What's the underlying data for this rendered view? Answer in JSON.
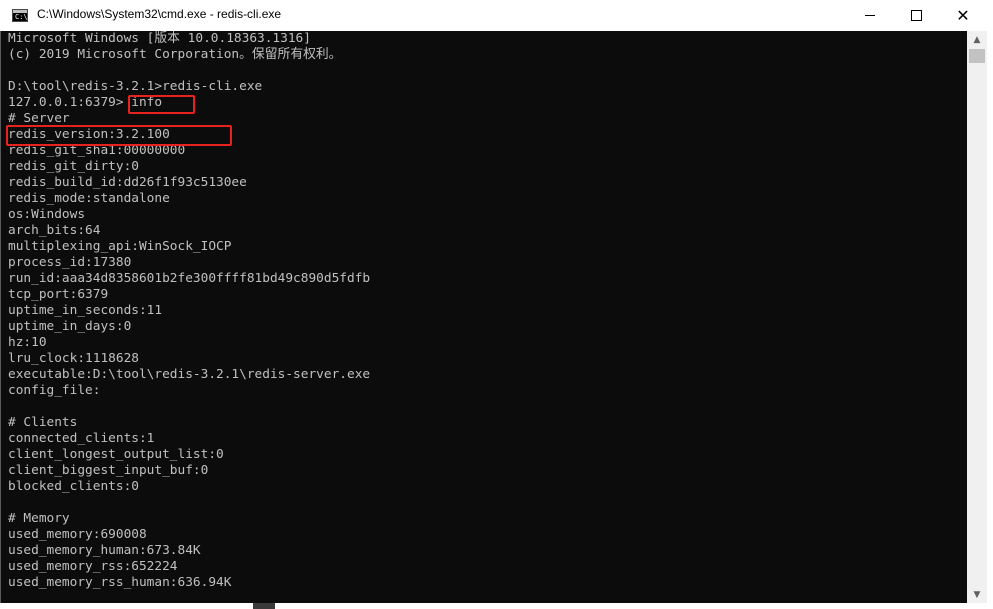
{
  "window": {
    "title": "C:\\Windows\\System32\\cmd.exe - redis-cli.exe",
    "icon": "cmd-icon",
    "icon_glyph": "C:\\",
    "minimize_label": "minimize",
    "maximize_label": "maximize",
    "close_label": "✕"
  },
  "console": {
    "lines": [
      "Microsoft Windows [版本 10.0.18363.1316]",
      "(c) 2019 Microsoft Corporation。保留所有权利。",
      "",
      "D:\\tool\\redis-3.2.1>redis-cli.exe",
      "127.0.0.1:6379> info",
      "# Server",
      "redis_version:3.2.100",
      "redis_git_sha1:00000000",
      "redis_git_dirty:0",
      "redis_build_id:dd26f1f93c5130ee",
      "redis_mode:standalone",
      "os:Windows",
      "arch_bits:64",
      "multiplexing_api:WinSock_IOCP",
      "process_id:17380",
      "run_id:aaa34d8358601b2fe300ffff81bd49c890d5fdfb",
      "tcp_port:6379",
      "uptime_in_seconds:11",
      "uptime_in_days:0",
      "hz:10",
      "lru_clock:1118628",
      "executable:D:\\tool\\redis-3.2.1\\redis-server.exe",
      "config_file:",
      "",
      "# Clients",
      "connected_clients:1",
      "client_longest_output_list:0",
      "client_biggest_input_buf:0",
      "blocked_clients:0",
      "",
      "# Memory",
      "used_memory:690008",
      "used_memory_human:673.84K",
      "used_memory_rss:652224",
      "used_memory_rss_human:636.94K"
    ]
  },
  "scrollbar": {
    "up_icon": "▲",
    "down_icon": "▼"
  },
  "colors": {
    "console_bg": "#0c0c0c",
    "console_text": "#c0c0c0",
    "highlight": "#e8231f"
  }
}
